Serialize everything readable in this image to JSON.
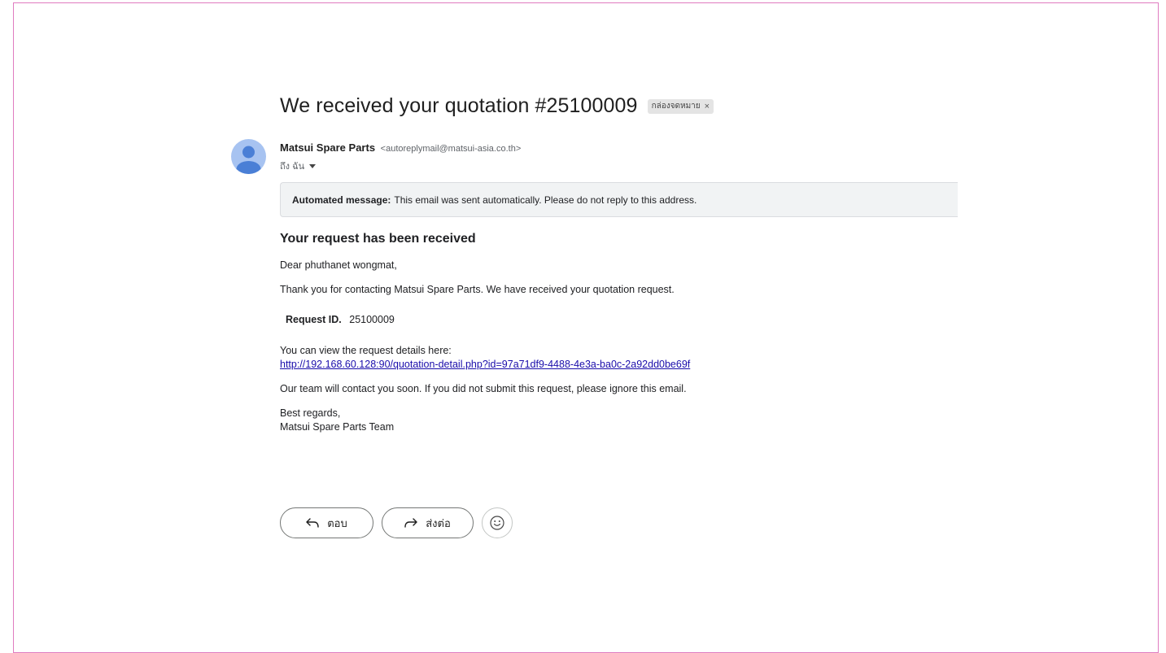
{
  "email": {
    "subject": "We received your quotation #25100009",
    "label_chip": "กล่องจดหมาย",
    "label_remove_glyph": "×",
    "sender": {
      "name": "Matsui Spare Parts",
      "email": "<autoreplymail@matsui-asia.co.th>"
    },
    "recipient_text": "ถึง ฉัน",
    "notice": {
      "bold": "Automated message:",
      "text": "This email was sent automatically. Please do not reply to this address."
    },
    "body": {
      "heading": "Your request has been received",
      "greeting": "Dear phuthanet wongmat,",
      "thanks": "Thank you for contacting Matsui Spare Parts. We have received your quotation request.",
      "request_id_label": "Request ID.",
      "request_id_value": "25100009",
      "view_text": "You can view the request details here:",
      "link": "http://192.168.60.128:90/quotation-detail.php?id=97a71df9-4488-4e3a-ba0c-2a92dd0be69f",
      "contact": "Our team will contact you soon. If you did not submit this request, please ignore this email.",
      "signoff": "Best regards,",
      "team": "Matsui Spare Parts Team"
    }
  },
  "actions": {
    "reply_label": "ตอบ",
    "forward_label": "ส่งต่อ",
    "reply_icon": "reply-arrow-icon",
    "forward_icon": "forward-arrow-icon",
    "emoji_icon": "smiley-icon"
  },
  "colors": {
    "frame_border": "#e07cc0",
    "avatar": "#a7c3f1",
    "avatar_figure": "#4a7fd6",
    "link": "#1a0dab",
    "notice_bg": "#f1f3f4"
  }
}
